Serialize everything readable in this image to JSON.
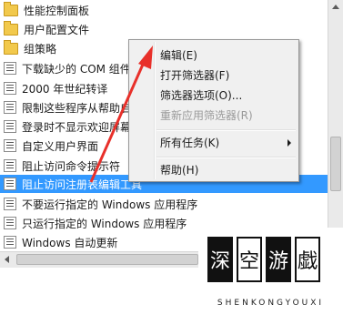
{
  "tree": {
    "items": [
      {
        "label": "性能控制面板",
        "icon": "folder-icon"
      },
      {
        "label": "用户配置文件",
        "icon": "folder-icon"
      },
      {
        "label": "组策略",
        "icon": "folder-icon"
      },
      {
        "label": "下载缺少的 COM 组件",
        "icon": "policy-icon"
      },
      {
        "label": "2000 年世纪转译",
        "icon": "policy-icon"
      },
      {
        "label": "限制这些程序从帮助启",
        "icon": "policy-icon"
      },
      {
        "label": "登录时不显示欢迎屏幕",
        "icon": "policy-icon"
      },
      {
        "label": "自定义用户界面",
        "icon": "policy-icon"
      },
      {
        "label": "阻止访问命令提示符",
        "icon": "policy-icon"
      },
      {
        "label": "阻止访问注册表编辑工具",
        "icon": "policy-icon",
        "selected": true
      },
      {
        "label": "不要运行指定的 Windows 应用程序",
        "icon": "policy-icon"
      },
      {
        "label": "只运行指定的 Windows 应用程序",
        "icon": "policy-icon"
      },
      {
        "label": "Windows 自动更新",
        "icon": "policy-icon"
      }
    ]
  },
  "context_menu": {
    "edit": "编辑(E)",
    "open_filter": "打开筛选器(F)",
    "filter_options": "筛选器选项(O)...",
    "reapply_filter": "重新应用筛选器(R)",
    "all_tasks": "所有任务(K)",
    "help": "帮助(H)"
  },
  "watermark": {
    "chars": [
      "深",
      "空",
      "游",
      "戯"
    ],
    "subtitle": "SHENKONGYOUXI"
  },
  "colors": {
    "selection": "#3399ff",
    "annotation_arrow": "#e8302a"
  }
}
